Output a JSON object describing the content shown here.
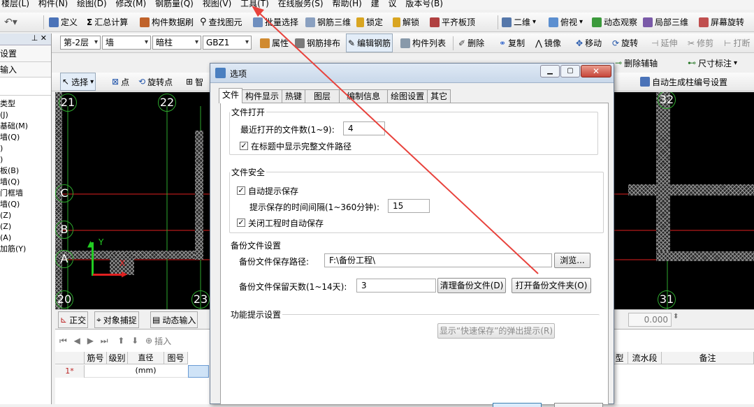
{
  "menubar": [
    "楼层(L)",
    "构件(N)",
    "绘图(D)",
    "修改(M)",
    "钢筋量(Q)",
    "视图(V)",
    "工具(T)",
    "在线服务(S)",
    "帮助(H)",
    "建",
    "议",
    "版本号(B)"
  ],
  "toolbar1": {
    "define": "定义",
    "sum_calc": "汇总计算",
    "data_refresh": "构件数据刷",
    "find_element": "查找图元",
    "batch_select": "批量选择",
    "rebar_3d": "钢筋三维",
    "lock": "锁定",
    "unlock": "解锁",
    "level_slab": "平齐板顶",
    "view_2d": "二维",
    "top_view": "俯视",
    "dynamic_view": "动态观察",
    "local_3d": "局部三维",
    "screen_rotate": "屏幕旋转"
  },
  "toolbar2": {
    "floor": "第-2层",
    "type": "墙",
    "subtype": "暗柱",
    "name": "GBZ1",
    "attr": "属性",
    "rebar_layout": "钢筋排布",
    "edit_rebar": "编辑钢筋",
    "element_list": "构件列表",
    "delete": "删除",
    "copy": "复制",
    "mirror": "镜像",
    "move": "移动",
    "rotate": "旋转",
    "extend": "延伸",
    "trim": "修剪",
    "break": "打断"
  },
  "toolbar3": {
    "select": "选择",
    "point": "点",
    "rotate_point": "旋转点",
    "smart": "智",
    "delete_axis": "删除辅轴",
    "dimension": "尺寸标注",
    "auto_number": "自动生成柱编号设置"
  },
  "left_panel": {
    "header1": "设置",
    "header2": "输入",
    "items": [
      "类型",
      "(J)",
      "基础(M)",
      "墙(Q)",
      ")",
      ")",
      "板(B)",
      "墙(Q)",
      "门框墙",
      "墙(Q)",
      "(Z)",
      "(Z)",
      "(A)",
      "加筋(Y)"
    ]
  },
  "canvas": {
    "axis_labels": [
      "21",
      "22",
      "C",
      "B",
      "A",
      "20",
      "23",
      "32",
      "31"
    ],
    "y_axis": "Y",
    "x_axis": "X"
  },
  "statusbar": {
    "ortho": "正交",
    "snap": "对象捕捉",
    "dynamic_input": "动态输入",
    "value": "0.000"
  },
  "table": {
    "insert": "插入",
    "columns": [
      "筋号",
      "级别",
      "直径(mm)",
      "图号"
    ],
    "right_columns": [
      "型",
      "流水段",
      "备注"
    ],
    "row_label": "1*"
  },
  "dialog": {
    "title": "选项",
    "tabs": [
      "文件",
      "构件显示",
      "热键",
      "图层",
      "编制信息",
      "绘图设置",
      "其它"
    ],
    "file_open": {
      "title": "文件打开",
      "recent_label": "最近打开的文件数(1~9):",
      "recent_value": "4",
      "show_path_label": "在标题中显示完整文件路径",
      "show_path_checked": true
    },
    "file_safety": {
      "title": "文件安全",
      "auto_save_label": "自动提示保存",
      "auto_save_checked": true,
      "interval_label": "提示保存的时间间隔(1~360分钟):",
      "interval_value": "15",
      "close_save_label": "关闭工程时自动保存",
      "close_save_checked": true
    },
    "backup": {
      "title": "备份文件设置",
      "path_label": "备份文件保存路径:",
      "path_value": "F:\\备份工程\\",
      "browse_button": "浏览...",
      "days_label": "备份文件保留天数(1~14天):",
      "days_value": "3",
      "clear_button": "清理备份文件(D)",
      "open_button": "打开备份文件夹(O)"
    },
    "hints": {
      "title": "功能提示设置",
      "quick_save_button": "显示“快速保存”的弹出提示(R)"
    }
  },
  "colors": {
    "canvas_bg": "#000000",
    "grid_red": "#e02020",
    "grid_green": "#2ea82e",
    "arrow": "#e8423c"
  }
}
